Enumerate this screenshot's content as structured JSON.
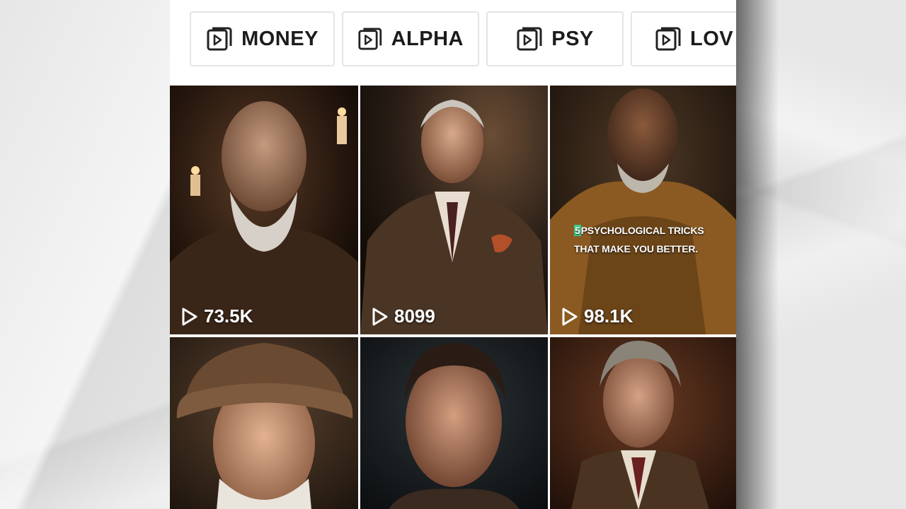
{
  "categories": [
    {
      "label": "MONEY",
      "icon": "play-square-icon"
    },
    {
      "label": "ALPHA",
      "icon": "play-square-icon"
    },
    {
      "label": "PSY",
      "icon": "play-square-icon"
    },
    {
      "label": "LOVE",
      "icon": "play-square-icon",
      "visible_text": "LOV"
    }
  ],
  "videos": [
    {
      "views": "73.5K",
      "subject": "bearded-elder-candles"
    },
    {
      "views": "8099",
      "subject": "man-in-suit"
    },
    {
      "views": "98.1K",
      "subject": "elder-in-robe",
      "caption_highlight": "5",
      "caption_line1": "PSYCHOLOGICAL TRICKS",
      "caption_line2": "THAT MAKE YOU BETTER."
    },
    {
      "views": "",
      "subject": "elder-with-hat"
    },
    {
      "views": "",
      "subject": "man-portrait"
    },
    {
      "views": "",
      "subject": "elder-in-vest"
    }
  ],
  "colors": {
    "accent_highlight": "#3ecf8e",
    "chip_border": "#e4e4e4",
    "background_paper": "#e6e6e6"
  }
}
